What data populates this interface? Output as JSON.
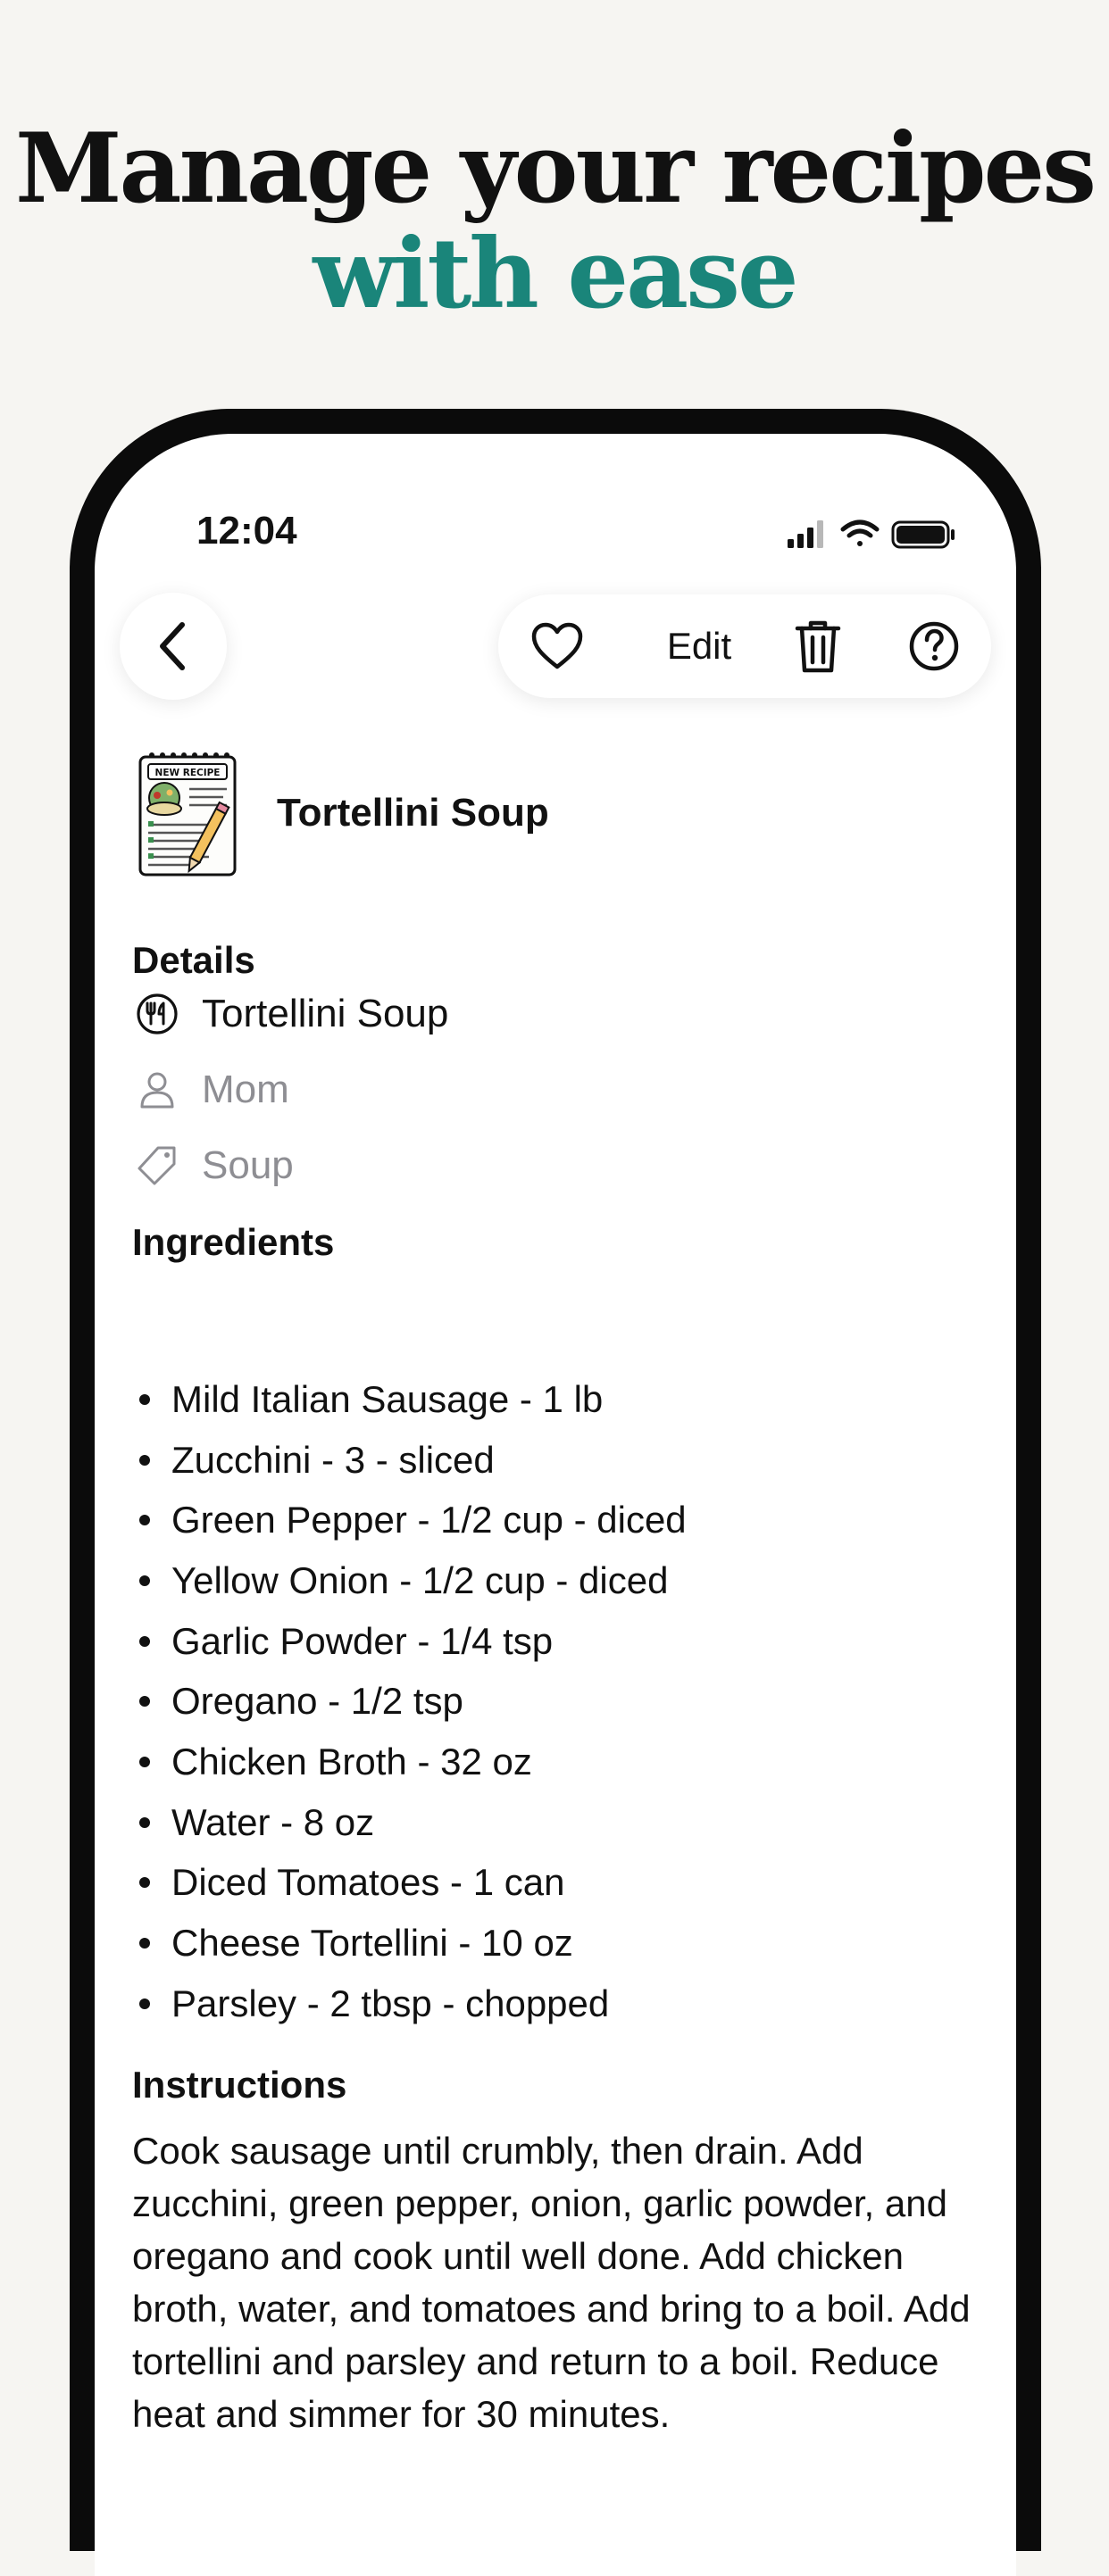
{
  "headline": {
    "line1": "Manage your recipes",
    "line2": "with ease"
  },
  "status_bar": {
    "time": "12:04",
    "icons": [
      "cellular-signal-icon",
      "wifi-icon",
      "battery-icon"
    ]
  },
  "toolbar": {
    "edit_label": "Edit",
    "icons": [
      "back-chevron-icon",
      "heart-icon",
      "trash-icon",
      "help-icon"
    ]
  },
  "recipe": {
    "thumbnail_label": "NEW RECIPE",
    "title": "Tortellini Soup"
  },
  "details": {
    "heading": "Details",
    "name": "Tortellini Soup",
    "author": "Mom",
    "category": "Soup"
  },
  "ingredients": {
    "heading": "Ingredients",
    "items": [
      "Mild Italian Sausage - 1 lb",
      "Zucchini - 3 - sliced",
      "Green Pepper - 1/2 cup - diced",
      "Yellow Onion - 1/2 cup - diced",
      "Garlic Powder - 1/4 tsp",
      "Oregano - 1/2 tsp",
      "Chicken Broth - 32 oz",
      "Water - 8 oz",
      "Diced Tomatoes - 1 can",
      "Cheese Tortellini - 10 oz",
      "Parsley - 2 tbsp - chopped"
    ]
  },
  "instructions": {
    "heading": "Instructions",
    "text": "Cook sausage until crumbly, then drain. Add zucchini, green pepper, onion, garlic powder, and oregano and cook until well done. Add chicken broth, water, and tomatoes and bring to a boil. Add tortellini and parsley and return to a boil. Reduce heat and simmer for 30 minutes."
  },
  "colors": {
    "accent": "#1a857a",
    "background": "#f6f5f2",
    "phone_frame": "#0b0b0b",
    "muted_text": "#8e8e93"
  }
}
